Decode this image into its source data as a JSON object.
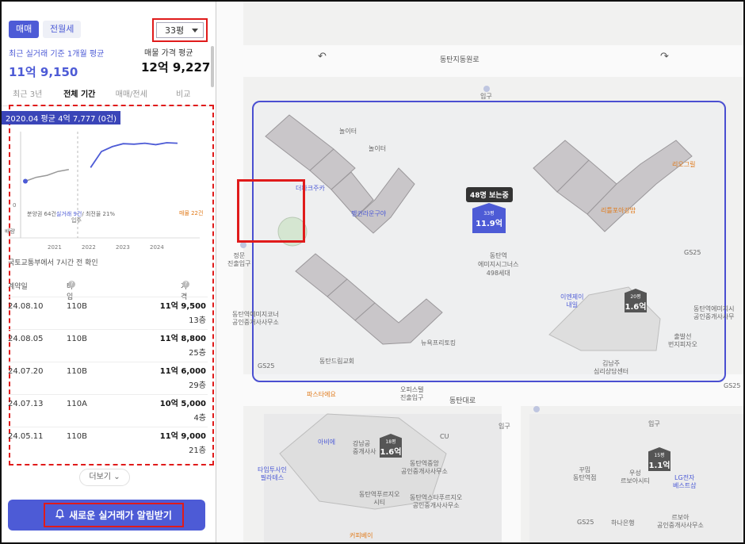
{
  "left_panel": {
    "tab_sale": "매매",
    "tab_lease": "전월세",
    "pyeong_select": "33평",
    "recent_label": "최근 실거래 기준 1개월 평균",
    "recent_value": "11억 9,150",
    "asking_label": "매물 가격 평균",
    "asking_value": "12억 9,227",
    "period_tabs": [
      "최근 3년",
      "전체 기간",
      "매매/전세",
      "비교"
    ],
    "chart_badge": "2020.04 평균 4억 7,777 (0건)",
    "chart_note": "분양권 64건",
    "chart_note_blue": "실거래 9건",
    "chart_note_tail": "/ 최전율 21%",
    "chart_note_move": "입주",
    "chart_asking": "매물 22건",
    "chart_side": "배량",
    "updated_text": "국토교통부에서 7시간 전 확인",
    "table_headers": {
      "date": "계약일",
      "type": "타입",
      "price": "가격"
    },
    "rows": [
      {
        "date": "24.08.10",
        "type": "110B",
        "price": "11억 9,500",
        "floor": "13층"
      },
      {
        "date": "24.08.05",
        "type": "110B",
        "price": "11억 8,800",
        "floor": "25층"
      },
      {
        "date": "24.07.20",
        "type": "110B",
        "price": "11억 6,000",
        "floor": "29층"
      },
      {
        "date": "24.07.13",
        "type": "110A",
        "price": "10억 5,000",
        "floor": "4층"
      },
      {
        "date": "24.05.11",
        "type": "110B",
        "price": "11억 9,000",
        "floor": "21층"
      }
    ],
    "more_button": "더보기",
    "alert_button": "새로운 실거래가 알림받기"
  },
  "chart_data": {
    "type": "line",
    "x_ticks": [
      "2021",
      "2022",
      "2023",
      "2024"
    ],
    "y_ticks": [
      "0"
    ],
    "series": [
      {
        "values": [
          4.8,
          5.6,
          6.0,
          6.8,
          7.2,
          7.5,
          7.6,
          10.9,
          11.9,
          12.5,
          12.4,
          12.6,
          12.3,
          12.7,
          12.6
        ]
      }
    ]
  },
  "map": {
    "tooltip": "48명 보는중",
    "selected_marker": {
      "size": "33평",
      "price": "11.9억"
    },
    "markers": [
      {
        "size": "20평",
        "price": "1.6억"
      },
      {
        "size": "18평",
        "price": "1.6억"
      },
      {
        "size": "15평",
        "price": "1.1억"
      }
    ],
    "labels": {
      "road_top": "동탄지동원로",
      "road_mid": "동탄대로",
      "entrance_top": "입구",
      "complex_name": "동탄역\n에미지시그너스\n498세대",
      "jeongmun": "정문\n진출입구",
      "gs25_a": "GS25",
      "gs25_b": "GS25",
      "gs25_c": "GS25",
      "dongtan_church": "동탄드림교회",
      "newyork": "뉴욕프리토킹",
      "coffee_paris": "파스타에요",
      "officetel": "오피스텔\n진출입구",
      "realtor_emi": "동탄역에미지코너\n공인중개사사무소",
      "irie": "이엔제이\n내일",
      "simri": "김남주\n심리상담센터",
      "bunji": "출발선\n번지피자오",
      "dongtan_st": "동탄역에미지시\n공인중개사사무",
      "orange_top": "리오그릴",
      "orange_mid": "리틀포아강밥",
      "blue_name_a": "더파크주카",
      "blue_name_b": "펭귄라운구야",
      "aibe": "아비에",
      "gangnam": "강남공\n중개사사",
      "cu": "CU",
      "tamnapil": "타임투사인\n필라테스",
      "dongtanyeok_center": "동탄역중앙\n공인중개사사무소",
      "dongtan_fortune": "동탄역푸르지오\n시티",
      "dongtan_st2": "동탄역스타푸르지오\n공인중개사사무소",
      "coffee_bay": "커피베이",
      "kumtim": "꾸밈\n동탄역점",
      "woosung": "우성\n르보아시티",
      "lg": "LG전자\n베스트샵",
      "hana": "하나은행",
      "gs25_d": "GS25",
      "reboa": "르보아\n공인중개사사무소",
      "garden_label": "놀이터",
      "garden_label2": "놀이터",
      "entrance_mid": "입구",
      "entrance_low": "입구"
    }
  }
}
